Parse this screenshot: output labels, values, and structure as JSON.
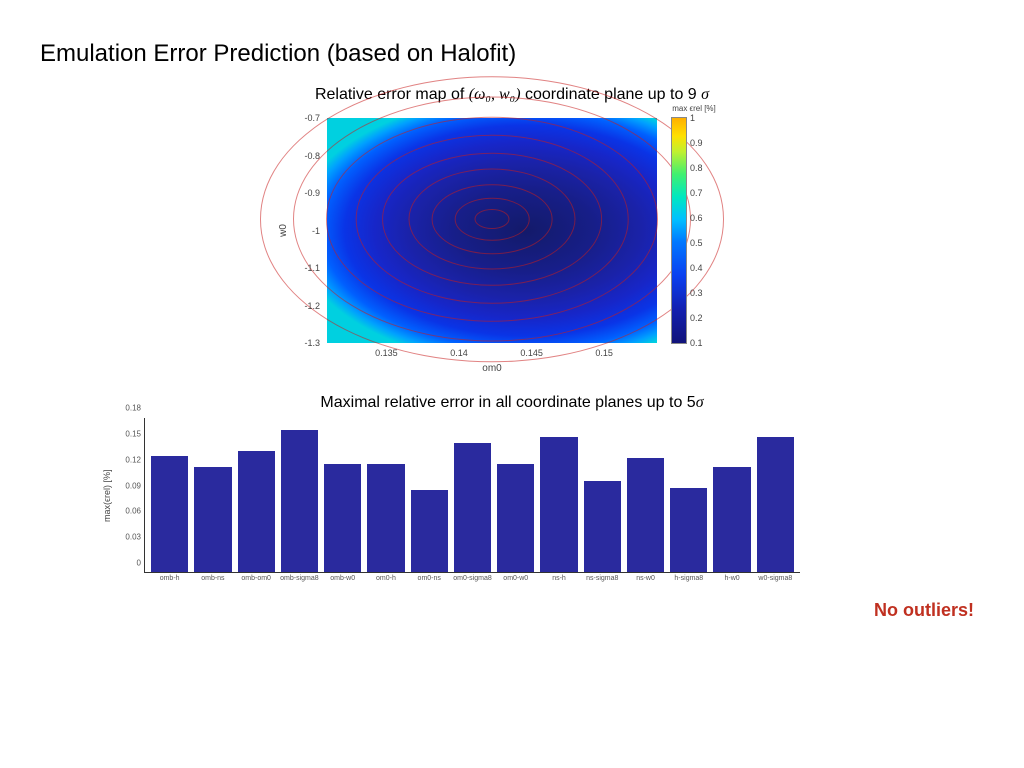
{
  "title": "Emulation Error Prediction (based on Halofit)",
  "subtitle1_pre": "Relative error map of ",
  "subtitle1_formula": "(ω₀, w₀)",
  "subtitle1_post": "coordinate plane up to 9 ",
  "subtitle1_sigma": "σ",
  "subtitle2_pre": "Maximal relative error in all coordinate planes up to 5",
  "subtitle2_sigma": "σ",
  "callout": "No outliers!",
  "heatmap": {
    "xlabel": "om0",
    "ylabel": "w0",
    "cb_title": "max ϵrel [%]",
    "xticks": [
      "0.135",
      "0.14",
      "0.145",
      "0.15"
    ],
    "xtick_pos_pct": [
      18,
      40,
      62,
      84
    ],
    "yticks": [
      "-0.7",
      "-0.8",
      "-0.9",
      "-1",
      "-1.1",
      "-1.2",
      "-1.3"
    ],
    "cb_ticks": [
      "1",
      "0.9",
      "0.8",
      "0.7",
      "0.6",
      "0.5",
      "0.4",
      "0.3",
      "0.2",
      "0.1"
    ]
  },
  "chart_data": {
    "type": "bar",
    "ylabel": "max(ϵrel) [%]",
    "ylim": [
      0,
      0.18
    ],
    "yticks": [
      0,
      0.03,
      0.06,
      0.09,
      0.12,
      0.15,
      0.18
    ],
    "categories": [
      "omb-h",
      "omb-ns",
      "omb-om0",
      "omb-sigma8",
      "omb-w0",
      "om0-h",
      "om0-ns",
      "om0-sigma8",
      "om0-w0",
      "ns-h",
      "ns-sigma8",
      "ns-w0",
      "h-sigma8",
      "h-w0",
      "w0-sigma8"
    ],
    "values": [
      0.135,
      0.122,
      0.14,
      0.165,
      0.126,
      0.125,
      0.095,
      0.15,
      0.125,
      0.157,
      0.106,
      0.132,
      0.098,
      0.122,
      0.157
    ]
  }
}
